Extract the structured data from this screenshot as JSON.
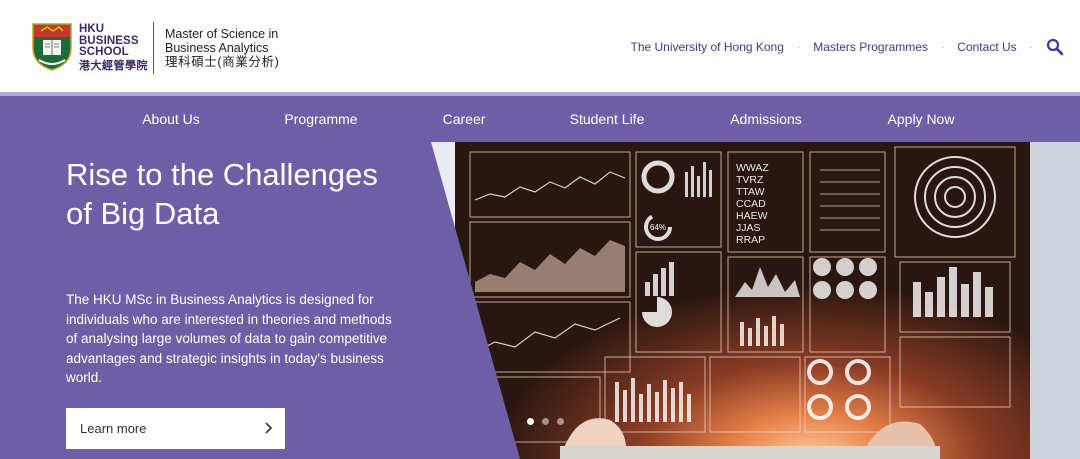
{
  "header": {
    "school_name": [
      "HKU",
      "BUSINESS",
      "SCHOOL"
    ],
    "school_name_cn": "港大經管學院",
    "programme_name_line1": "Master of Science in",
    "programme_name_line2": "Business Analytics",
    "programme_name_cn": "理科碩士(商業分析)",
    "top_links": [
      "The University of Hong Kong",
      "Masters Programmes",
      "Contact Us"
    ]
  },
  "nav": {
    "items": [
      "About Us",
      "Programme",
      "Career",
      "Student Life",
      "Admissions",
      "Apply Now"
    ]
  },
  "hero": {
    "title": "Rise to the Challenges of Big Data",
    "description": "The HKU MSc in Business Analytics is designed for individuals who are interested in theories and methods of analysing large volumes of data to gain competitive advantages and strategic insights in today's business world.",
    "cta_label": "Learn more",
    "slides_total": 3,
    "active_slide": 1,
    "photo_text": [
      "WWAZ",
      "TVRZ",
      "TTAW",
      "CCAD",
      "HAEW",
      "JJAS",
      "RRAP"
    ],
    "photo_percent": "64%"
  },
  "colors": {
    "brand_purple": "#6e5ea6",
    "nav_border": "#b7acd8",
    "link_blue": "#3e3a87",
    "logo_text": "#3c2a63"
  }
}
